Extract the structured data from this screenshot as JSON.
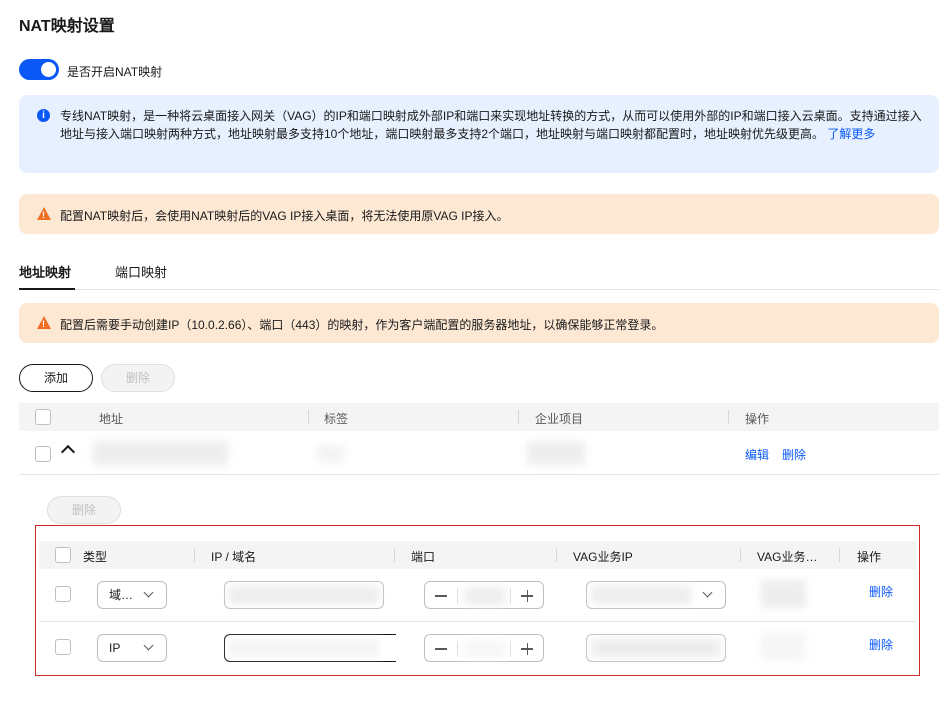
{
  "page": {
    "title": "NAT映射设置"
  },
  "toggle": {
    "label": "是否开启NAT映射",
    "on": true
  },
  "info": {
    "text": "专线NAT映射，是一种将云桌面接入网关（VAG）的IP和端口映射成外部IP和端口来实现地址转换的方式，从而可以使用外部的IP和端口接入云桌面。支持通过接入地址与接入端口映射两种方式，地址映射最多支持10个地址，端口映射最多支持2个端口，地址映射与端口映射都配置时，地址映射优先级更高。",
    "link": "了解更多"
  },
  "warning1": {
    "text": "配置NAT映射后，会使用NAT映射后的VAG IP接入桌面，将无法使用原VAG IP接入。"
  },
  "tabs": [
    {
      "label": "地址映射",
      "active": true
    },
    {
      "label": "端口映射",
      "active": false
    }
  ],
  "warning2": {
    "text": "配置后需要手动创建IP（10.0.2.66）、端口（443）的映射，作为客户端配置的服务器地址，以确保能够正常登录。"
  },
  "toolbar": {
    "add_label": "添加",
    "delete_label": "删除"
  },
  "table": {
    "headers": [
      "地址",
      "标签",
      "企业项目",
      "操作"
    ],
    "row": {
      "actions": [
        "编辑",
        "删除"
      ]
    }
  },
  "subtable": {
    "delete_label": "删除",
    "headers": [
      "类型",
      "IP / 域名",
      "端口",
      "VAG业务IP",
      "VAG业务…",
      "操作"
    ],
    "rows": [
      {
        "type": "域…",
        "action": "删除"
      },
      {
        "type": "IP",
        "action": "删除"
      }
    ]
  },
  "colors": {
    "accent": "#0a59f7",
    "warning": "#ed6f21",
    "frame": "#d42929"
  }
}
